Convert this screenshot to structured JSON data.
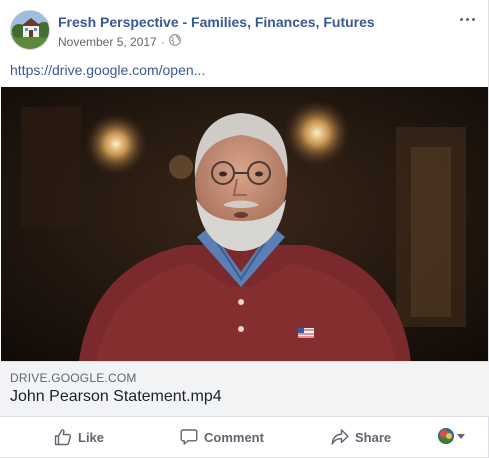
{
  "post": {
    "page_name": "Fresh Perspective - Families, Finances, Futures",
    "date": "November 5, 2017",
    "separator": "·",
    "privacy_icon": "globe-icon",
    "more_icon": "more-options-icon",
    "link_text": "https://drive.google.com/open...",
    "attachment": {
      "domain": "DRIVE.GOOGLE.COM",
      "title": "John Pearson Statement.mp4"
    }
  },
  "actions": {
    "like_label": "Like",
    "comment_label": "Comment",
    "share_label": "Share",
    "like_icon": "thumbs-up-icon",
    "comment_icon": "speech-bubble-icon",
    "share_icon": "share-arrow-icon"
  },
  "colors": {
    "link_blue": "#385898",
    "muted_text": "#606770",
    "caption_bg": "#f2f3f5"
  }
}
